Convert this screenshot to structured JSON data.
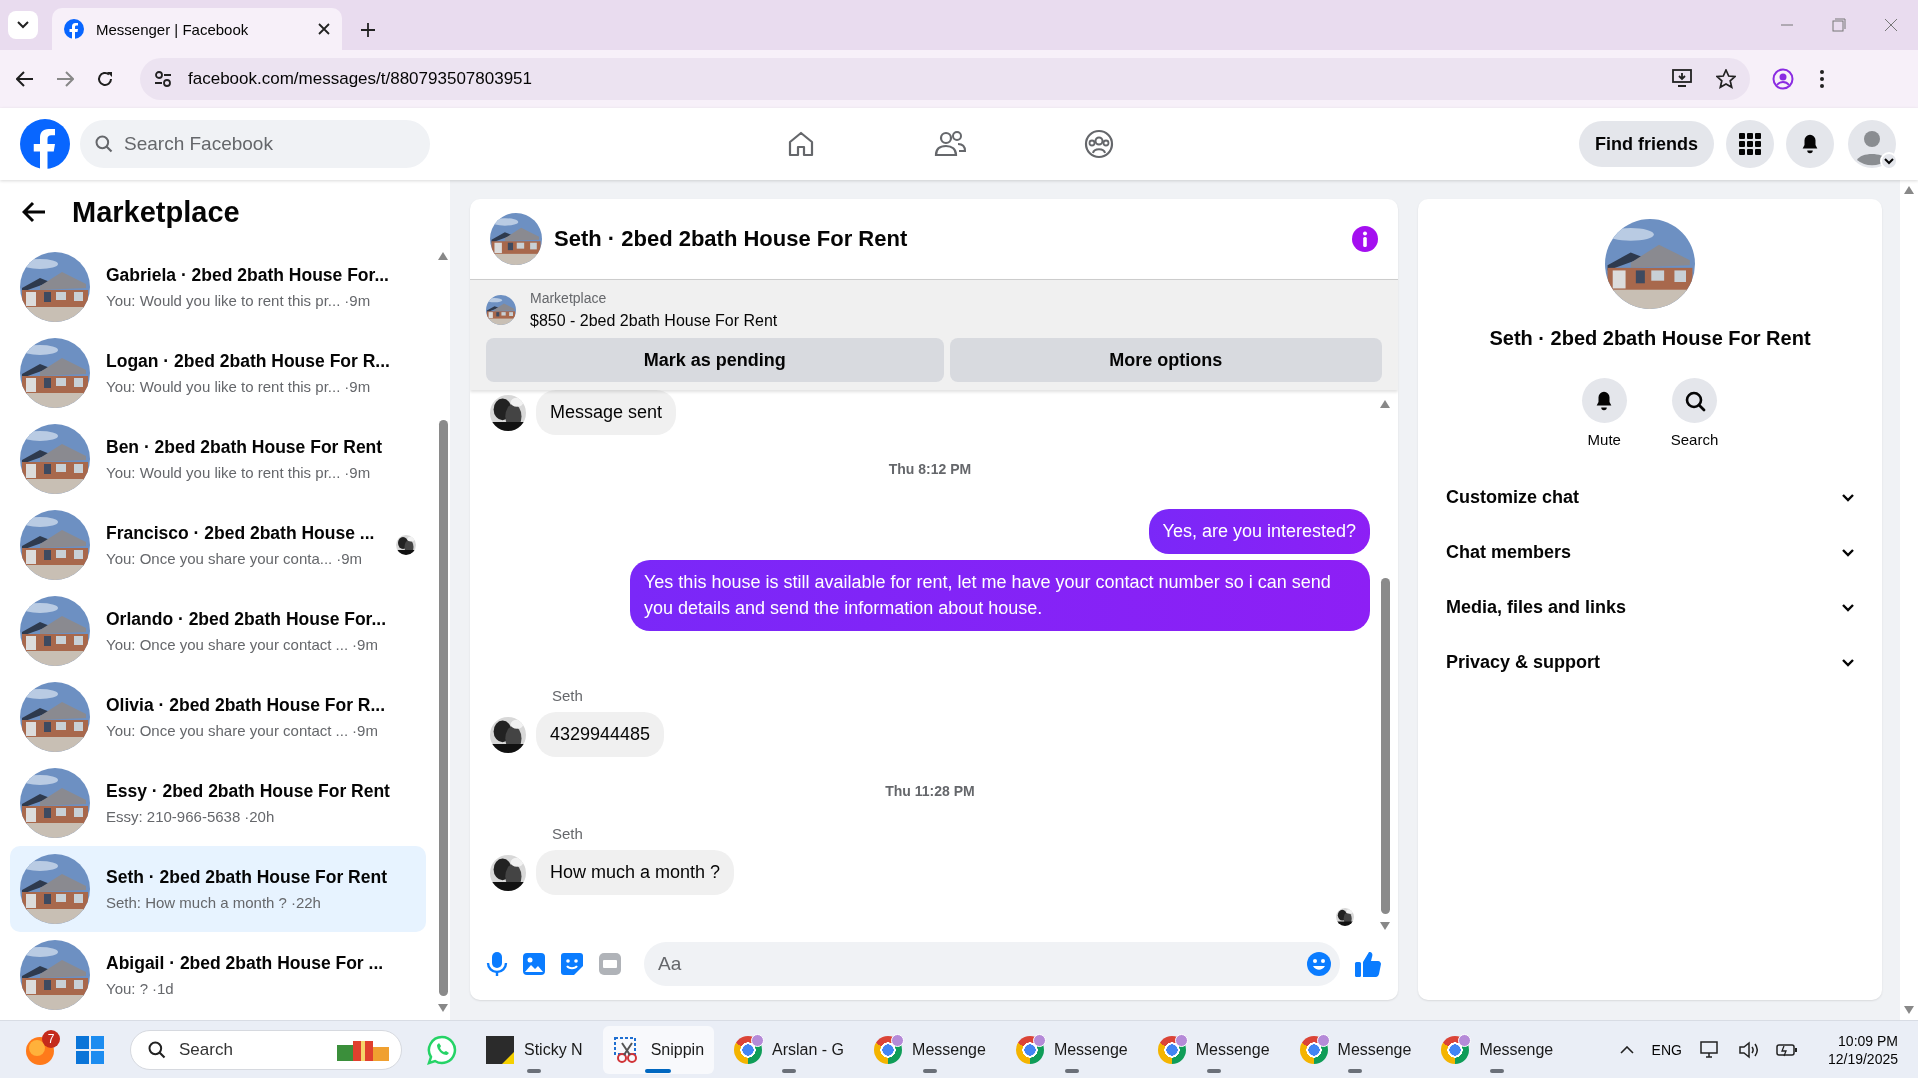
{
  "browser": {
    "tabs": [
      {
        "title": "Messenger | Facebook",
        "selected": true
      }
    ],
    "url": "facebook.com/messages/t/880793507803951"
  },
  "header": {
    "search_placeholder": "Search Facebook",
    "find_friends": "Find friends"
  },
  "sidebar": {
    "title": "Marketplace",
    "conversations": [
      {
        "title": "Gabriela · 2bed 2bath House For...",
        "preview": "You: Would you like to rent this pr...",
        "time": "·9m",
        "seen": false,
        "selected": false
      },
      {
        "title": "Logan · 2bed 2bath House For R...",
        "preview": "You: Would you like to rent this pr...",
        "time": "·9m",
        "seen": false,
        "selected": false
      },
      {
        "title": "Ben · 2bed 2bath House For Rent",
        "preview": "You: Would you like to rent this pr...",
        "time": "·9m",
        "seen": false,
        "selected": false
      },
      {
        "title": "Francisco · 2bed 2bath House ...",
        "preview": "You: Once you share your conta...",
        "time": "·9m",
        "seen": true,
        "selected": false
      },
      {
        "title": "Orlando · 2bed 2bath House For...",
        "preview": "You: Once you share your contact ...",
        "time": "·9m",
        "seen": false,
        "selected": false
      },
      {
        "title": "Olivia · 2bed 2bath House For R...",
        "preview": "You: Once you share your contact ...",
        "time": "·9m",
        "seen": false,
        "selected": false
      },
      {
        "title": "Essy · 2bed 2bath House For Rent",
        "preview": "Essy: 210-966-5638",
        "time": "·20h",
        "seen": false,
        "selected": false
      },
      {
        "title": "Seth · 2bed 2bath House For Rent",
        "preview": "Seth: How much a month ?",
        "time": "·22h",
        "seen": false,
        "selected": true
      },
      {
        "title": "Abigail · 2bed 2bath House For ...",
        "preview": "You: ?",
        "time": "·1d",
        "seen": false,
        "selected": false
      }
    ]
  },
  "chat": {
    "title": "Seth · 2bed 2bath House For Rent",
    "listing": {
      "label": "Marketplace",
      "item": "$850 - 2bed 2bath House For Rent"
    },
    "actions": [
      "Mark as pending",
      "More options"
    ],
    "messages": [
      {
        "kind": "incoming",
        "text": "Message sent"
      },
      {
        "kind": "timestamp",
        "text": "Thu 8:12 PM"
      },
      {
        "kind": "outgoing",
        "text": "Yes, are you interested?"
      },
      {
        "kind": "outgoing",
        "text": "Yes this house is still available for rent, let me have your contact number so i can send you details and send the information about house."
      },
      {
        "kind": "incoming",
        "sender": "Seth",
        "text": "4329944485"
      },
      {
        "kind": "timestamp",
        "text": "Thu 11:28 PM"
      },
      {
        "kind": "incoming",
        "sender": "Seth",
        "text": "How much a month ?"
      }
    ],
    "composer": {
      "placeholder": "Aa"
    }
  },
  "details": {
    "title": "Seth · 2bed 2bath House For Rent",
    "actions": [
      {
        "kind": "mute",
        "label": "Mute"
      },
      {
        "kind": "search",
        "label": "Search"
      }
    ],
    "sections": [
      {
        "label": "Customize chat",
        "expanded": false
      },
      {
        "label": "Chat members",
        "expanded": false
      },
      {
        "label": "Media, files and links",
        "expanded": false
      },
      {
        "label": "Privacy & support",
        "expanded": false
      }
    ]
  },
  "taskbar": {
    "items": [
      {
        "kind": "fox",
        "badge": "7"
      },
      {
        "kind": "start"
      },
      {
        "kind": "search",
        "placeholder": "Search"
      },
      {
        "kind": "whatsapp"
      },
      {
        "kind": "sticky",
        "label": "Sticky N",
        "running": true,
        "selected": false
      },
      {
        "kind": "snip",
        "label": "Snippin",
        "running": true,
        "selected": true
      },
      {
        "kind": "chrome",
        "label": "Arslan - G",
        "running": true,
        "selected": false
      },
      {
        "kind": "chrome",
        "label": "Messenge",
        "running": true,
        "selected": false
      },
      {
        "kind": "chrome",
        "label": "Messenge",
        "running": true,
        "selected": false
      },
      {
        "kind": "chrome",
        "label": "Messenge",
        "running": true,
        "selected": false
      },
      {
        "kind": "chrome",
        "label": "Messenge",
        "running": true,
        "selected": false
      },
      {
        "kind": "chrome",
        "label": "Messenge",
        "running": true,
        "selected": false
      }
    ],
    "tray": {
      "language": "ENG",
      "time": "10:09 PM",
      "date": "12/19/2025"
    }
  }
}
